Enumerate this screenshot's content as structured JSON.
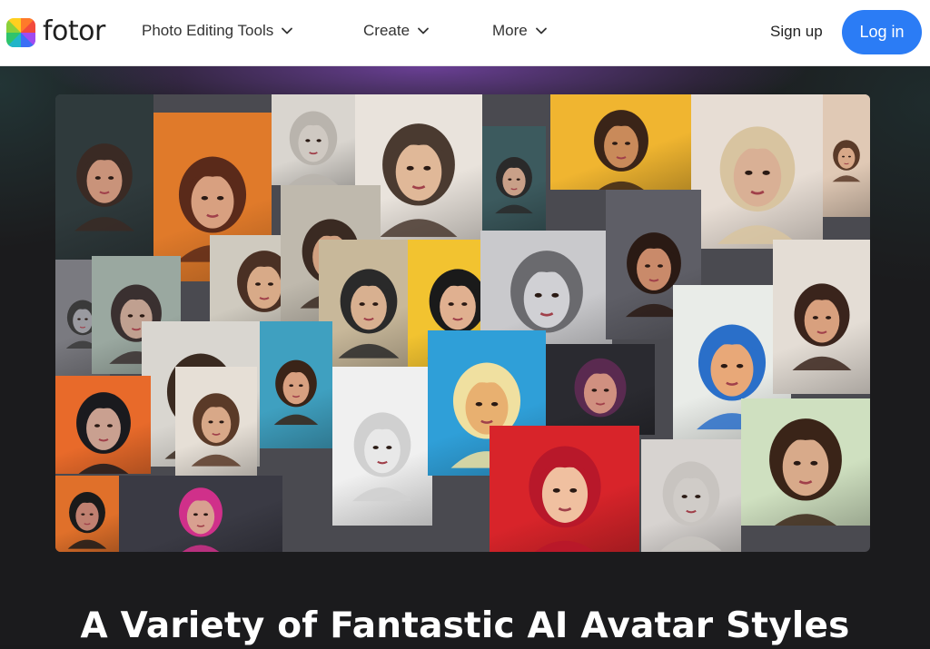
{
  "brand": {
    "name": "fotor"
  },
  "nav": {
    "items": [
      {
        "label": "Photo Editing Tools",
        "icon": "chevron-down-icon"
      },
      {
        "label": "Create",
        "icon": "chevron-down-icon"
      },
      {
        "label": "More",
        "icon": "chevron-down-icon"
      }
    ],
    "signup_label": "Sign up",
    "login_label": "Log in"
  },
  "hero": {
    "headline": "A Variety of Fantastic AI Avatar Styles"
  },
  "colors": {
    "accent": "#2b7cf5",
    "navbar_bg": "#ffffff",
    "page_bg": "#1b1b1d",
    "headline": "#ffffff"
  }
}
